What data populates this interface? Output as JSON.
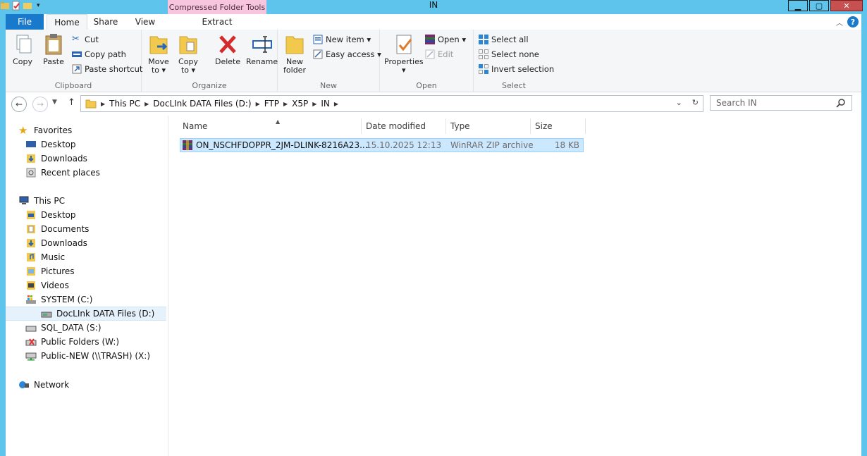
{
  "window": {
    "title": "IN",
    "context_tab_header": "Compressed Folder Tools"
  },
  "tabs": {
    "file": "File",
    "home": "Home",
    "share": "Share",
    "view": "View",
    "extract": "Extract"
  },
  "ribbon": {
    "clipboard": {
      "label": "Clipboard",
      "copy": "Copy",
      "paste": "Paste",
      "cut": "Cut",
      "copy_path": "Copy path",
      "paste_shortcut": "Paste shortcut"
    },
    "organize": {
      "label": "Organize",
      "move_to_1": "Move",
      "move_to_2": "to ▾",
      "copy_to_1": "Copy",
      "copy_to_2": "to ▾",
      "delete": "Delete",
      "rename": "Rename"
    },
    "new": {
      "label": "New",
      "new_folder_1": "New",
      "new_folder_2": "folder",
      "new_item": "New item ▾",
      "easy_access": "Easy access ▾"
    },
    "open": {
      "label": "Open",
      "properties": "Properties",
      "properties_drop": "▾",
      "open": "Open ▾",
      "edit": "Edit"
    },
    "select": {
      "label": "Select",
      "select_all": "Select all",
      "select_none": "Select none",
      "invert_selection": "Invert selection"
    }
  },
  "address": {
    "crumbs": [
      "This PC",
      "DocLInk DATA Files (D:)",
      "FTP",
      "X5P",
      "IN"
    ],
    "search_placeholder": "Search IN"
  },
  "nav": {
    "favorites": "Favorites",
    "fav_desktop": "Desktop",
    "fav_downloads": "Downloads",
    "fav_recent": "Recent places",
    "this_pc": "This PC",
    "pc_desktop": "Desktop",
    "pc_documents": "Documents",
    "pc_downloads": "Downloads",
    "pc_music": "Music",
    "pc_pictures": "Pictures",
    "pc_videos": "Videos",
    "drive_c": "SYSTEM (C:)",
    "drive_d": "DocLInk DATA Files (D:)",
    "drive_s": "SQL_DATA (S:)",
    "drive_w": "Public Folders (W:)",
    "drive_x": "Public-NEW (\\\\TRASH) (X:)",
    "network": "Network"
  },
  "columns": {
    "name": "Name",
    "date_modified": "Date modified",
    "type": "Type",
    "size": "Size"
  },
  "files": [
    {
      "name": "ON_NSCHFDOPPR_2JM-DLINK-8216A23...",
      "date_modified": "15.10.2025 12:13",
      "type": "WinRAR ZIP archive",
      "size": "18 KB"
    }
  ],
  "colors": {
    "chrome": "#5fc4ec",
    "file_tab": "#1979ca",
    "context_tab": "#f7c6de",
    "selection": "#cce8ff"
  }
}
